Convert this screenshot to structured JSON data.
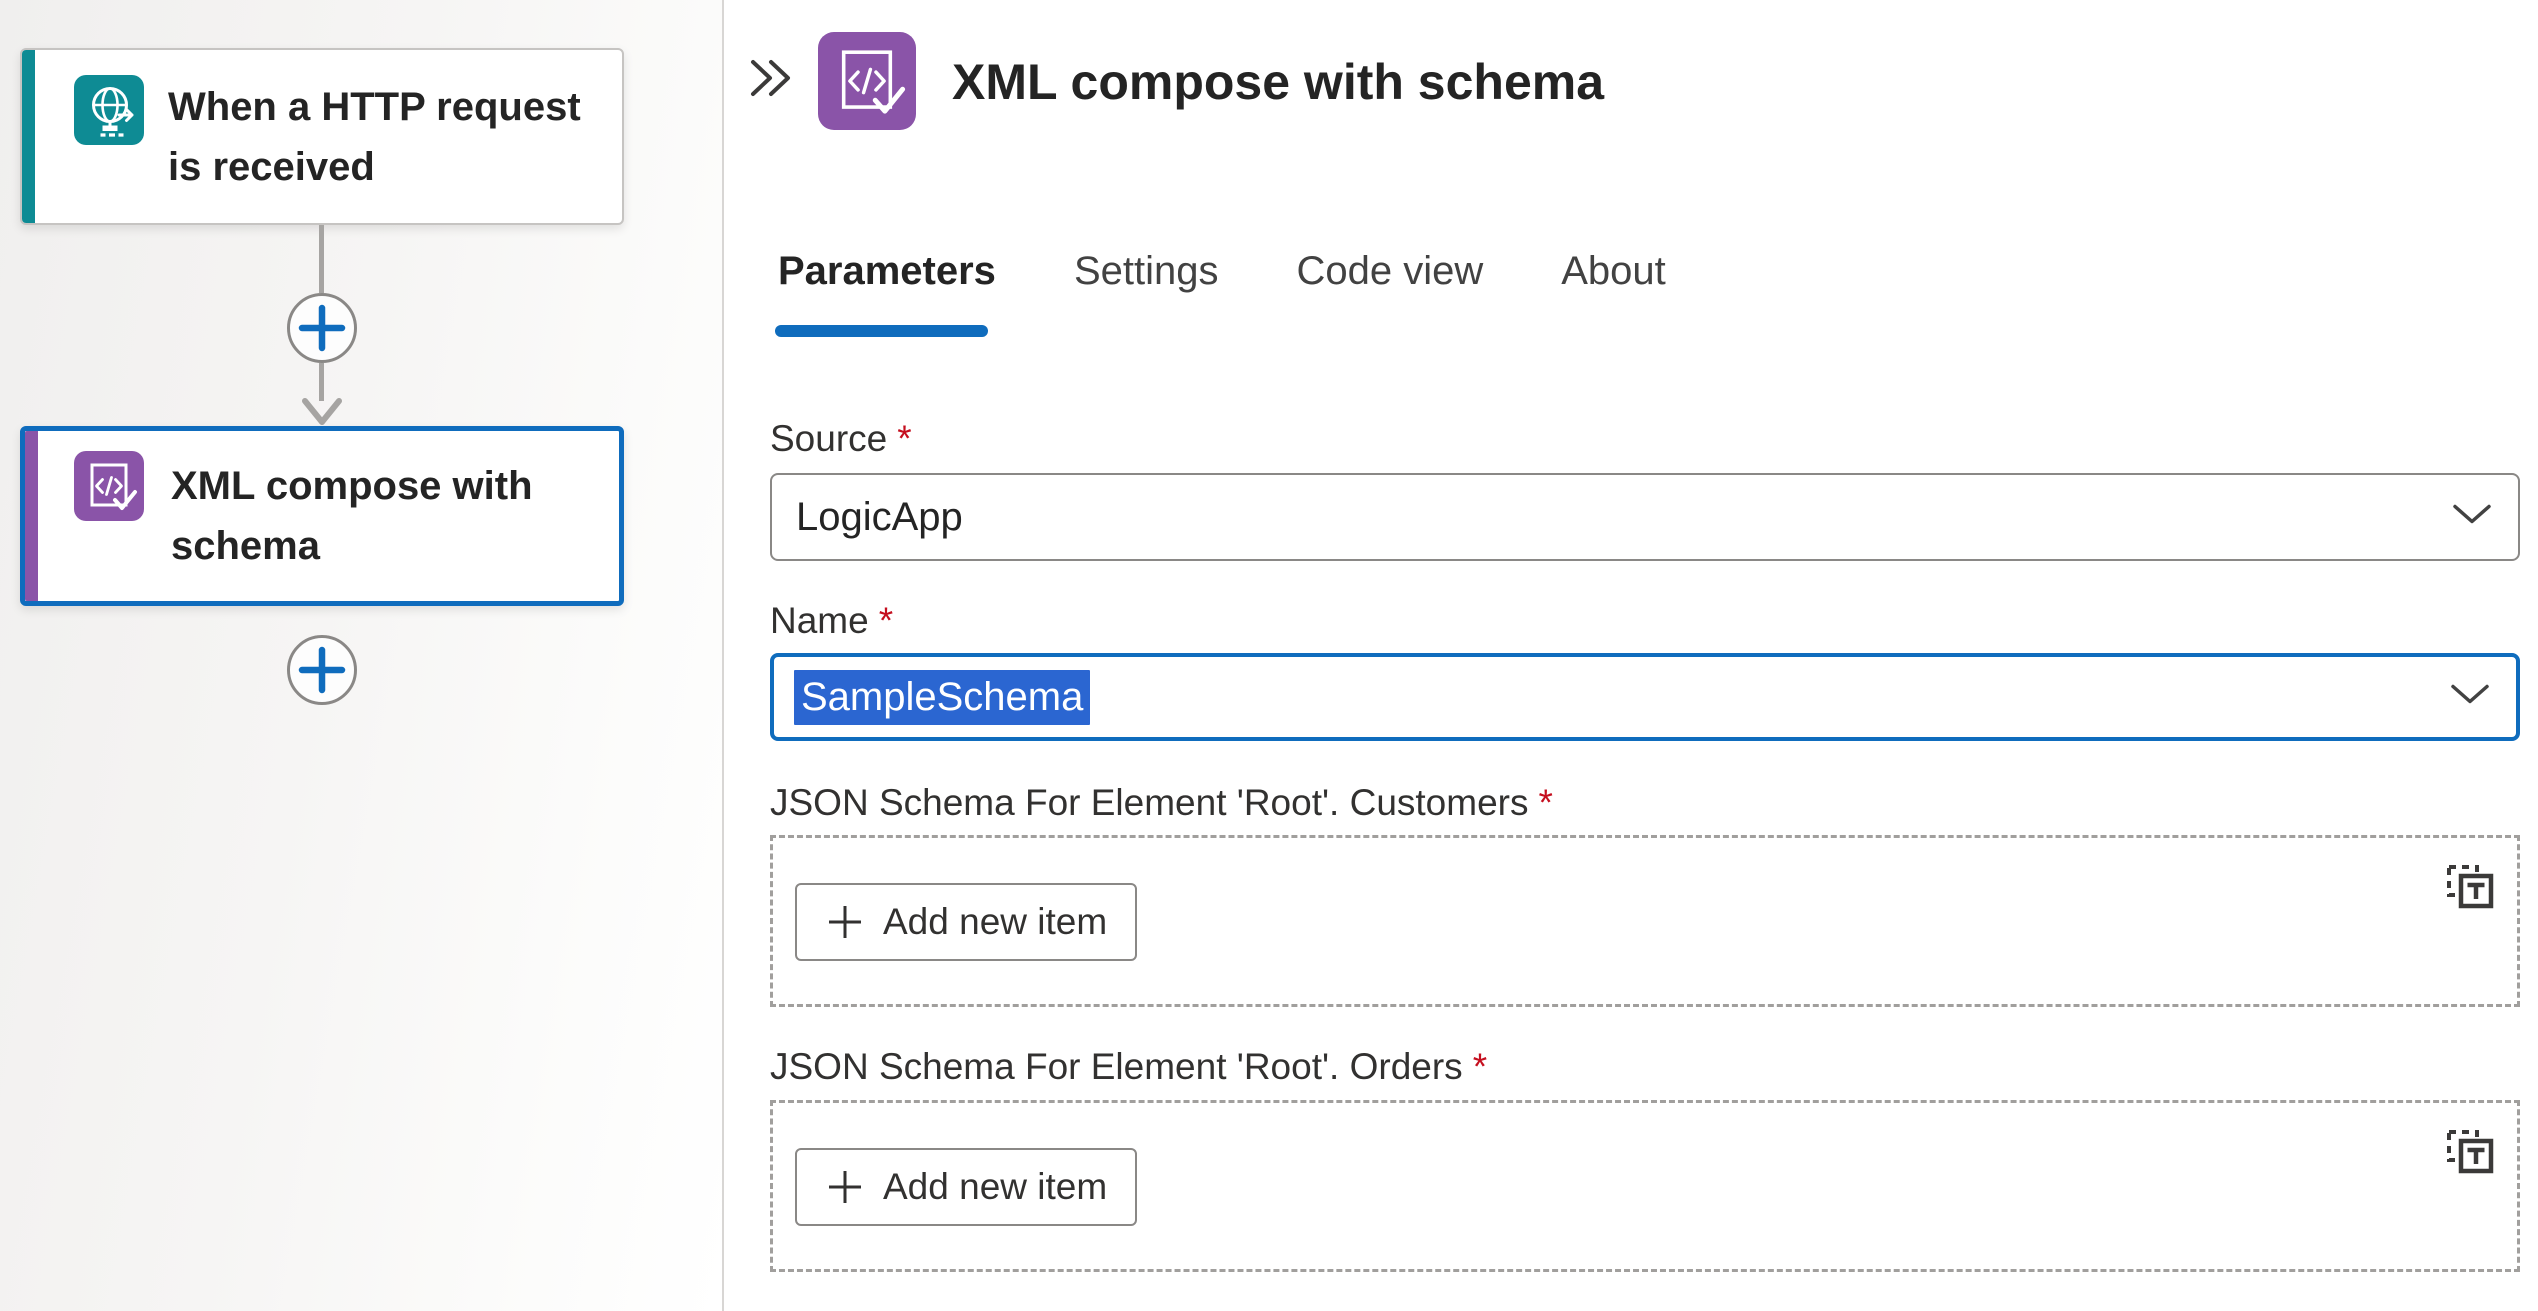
{
  "canvas": {
    "nodes": [
      {
        "title": "When a HTTP request is received",
        "icon": "http-request-icon",
        "accent_color": "#0e8b94",
        "selected": false
      },
      {
        "title": "XML compose with schema",
        "icon": "xml-compose-icon",
        "accent_color": "#8a54a8",
        "selected": true
      }
    ],
    "insert_step_icon": "plus-icon",
    "connector_arrow_icon": "arrow-down-icon"
  },
  "panel": {
    "collapse_icon": "double-chevron-right-icon",
    "header_icon": "xml-compose-icon",
    "title": "XML compose with schema",
    "tabs": [
      {
        "label": "Parameters",
        "active": true
      },
      {
        "label": "Settings",
        "active": false
      },
      {
        "label": "Code view",
        "active": false
      },
      {
        "label": "About",
        "active": false
      }
    ],
    "required_marker": "*",
    "fields": {
      "source": {
        "label": "Source",
        "required": true,
        "value": "LogicApp",
        "control": "dropdown"
      },
      "name": {
        "label": "Name",
        "required": true,
        "value": "SampleSchema",
        "control": "combobox",
        "text_selected": true
      }
    },
    "sections": [
      {
        "label": "JSON Schema For Element 'Root'. Customers",
        "required": true,
        "button_label": "Add new item",
        "toggle_icon": "text-mode-toggle-icon"
      },
      {
        "label": "JSON Schema For Element 'Root'. Orders",
        "required": true,
        "button_label": "Add new item",
        "toggle_icon": "text-mode-toggle-icon"
      }
    ]
  },
  "colors": {
    "accent_blue": "#0f6cbd",
    "selection_blue": "#2b66d1",
    "trigger_teal": "#0e8b94",
    "action_purple": "#8a54a8",
    "required_red": "#c50f1f",
    "field_border": "#8a8886",
    "dashed_border": "#a19f9d",
    "connector_gray": "#a6a4a2"
  }
}
